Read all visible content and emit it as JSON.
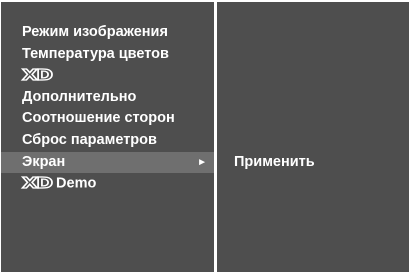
{
  "menu": {
    "items": [
      {
        "label": "Режим изображения",
        "logo": ""
      },
      {
        "label": "Температура цветов",
        "logo": ""
      },
      {
        "label": "",
        "logo": "XD"
      },
      {
        "label": "Дополнительно",
        "logo": ""
      },
      {
        "label": "Соотношение сторон",
        "logo": ""
      },
      {
        "label": "Сброс параметров",
        "logo": ""
      },
      {
        "label": "Экран",
        "logo": "",
        "arrow": "►",
        "selected": true
      },
      {
        "label": "Demo",
        "logo": "XD"
      }
    ]
  },
  "submenu": {
    "apply_label": "Применить"
  },
  "colors": {
    "panel_background": "#4e4e4e",
    "highlight": "#6f6f6f",
    "text": "#ffffff",
    "page_background": "#ffffff"
  }
}
